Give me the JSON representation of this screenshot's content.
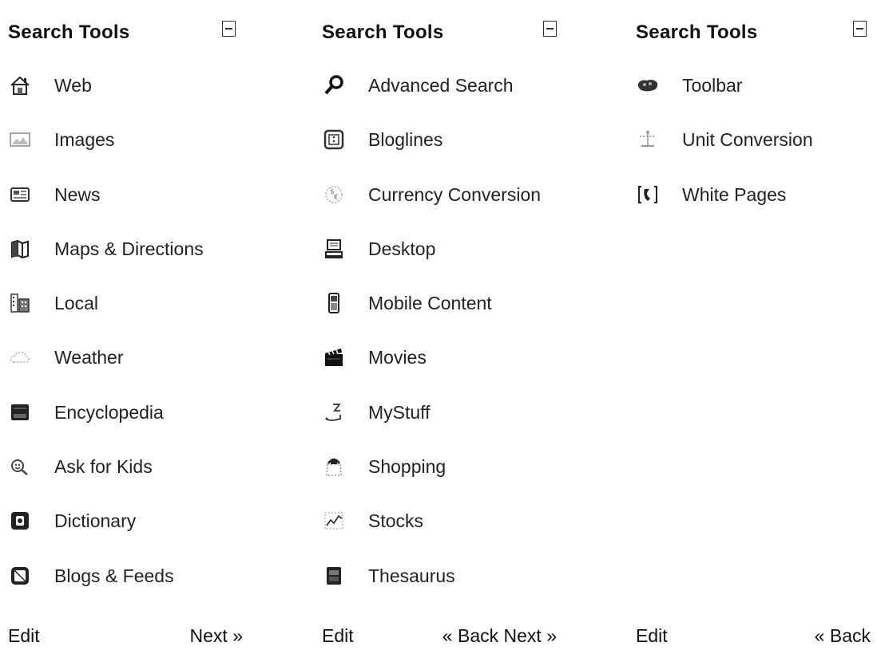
{
  "panels": [
    {
      "title": "Search Tools",
      "items": [
        {
          "label": "Web",
          "icon": "house-icon"
        },
        {
          "label": "Images",
          "icon": "image-icon"
        },
        {
          "label": "News",
          "icon": "newspaper-icon"
        },
        {
          "label": "Maps & Directions",
          "icon": "map-icon"
        },
        {
          "label": "Local",
          "icon": "buildings-icon"
        },
        {
          "label": "Weather",
          "icon": "cloud-icon"
        },
        {
          "label": "Encyclopedia",
          "icon": "book-icon"
        },
        {
          "label": "Ask for Kids",
          "icon": "kids-icon"
        },
        {
          "label": "Dictionary",
          "icon": "dictionary-icon"
        },
        {
          "label": "Blogs & Feeds",
          "icon": "feeds-icon"
        }
      ],
      "footer": {
        "edit": "Edit",
        "back": "",
        "next": "Next »"
      }
    },
    {
      "title": "Search Tools",
      "items": [
        {
          "label": "Advanced Search",
          "icon": "magnifier-icon"
        },
        {
          "label": "Bloglines",
          "icon": "bloglines-icon"
        },
        {
          "label": "Currency Conversion",
          "icon": "currency-icon"
        },
        {
          "label": "Desktop",
          "icon": "computer-icon"
        },
        {
          "label": "Mobile Content",
          "icon": "mobile-phone-icon"
        },
        {
          "label": "Movies",
          "icon": "clapperboard-icon"
        },
        {
          "label": "MyStuff",
          "icon": "mystuff-icon"
        },
        {
          "label": "Shopping",
          "icon": "shopping-bag-icon"
        },
        {
          "label": "Stocks",
          "icon": "stock-chart-icon"
        },
        {
          "label": "Thesaurus",
          "icon": "thesaurus-icon"
        }
      ],
      "footer": {
        "edit": "Edit",
        "back": "« Back",
        "next": "Next »"
      }
    },
    {
      "title": "Search Tools",
      "items": [
        {
          "label": "Toolbar",
          "icon": "toolbar-icon"
        },
        {
          "label": "Unit Conversion",
          "icon": "scale-icon"
        },
        {
          "label": "White Pages",
          "icon": "phone-book-icon"
        }
      ],
      "footer": {
        "edit": "Edit",
        "back": "« Back",
        "next": ""
      }
    }
  ]
}
